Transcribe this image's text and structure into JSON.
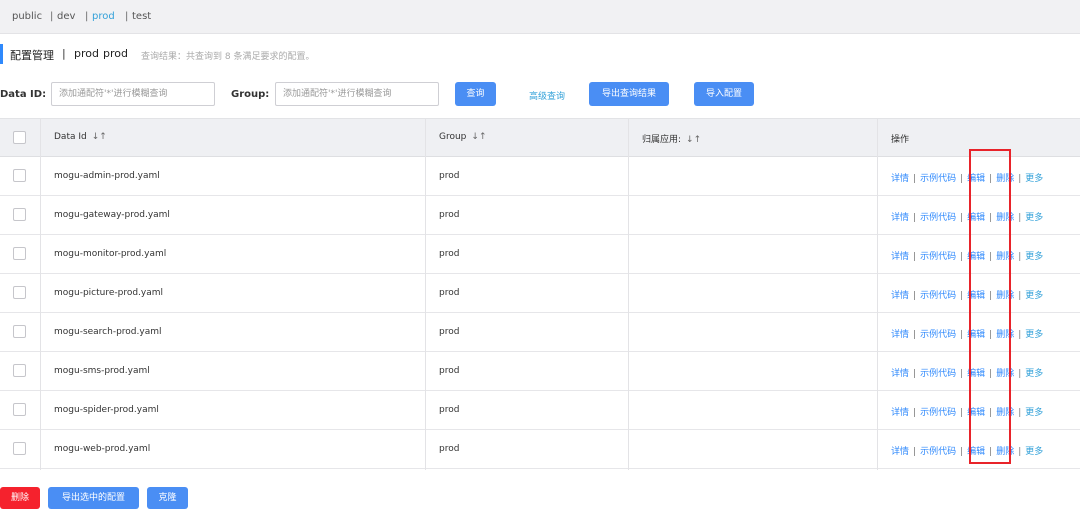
{
  "namespaces": {
    "items": [
      "public",
      "dev",
      "prod",
      "test"
    ],
    "separator": "|",
    "active": "prod"
  },
  "header": {
    "title": "配置管理",
    "separator": "|",
    "namespace_name": "prod",
    "namespace_id": "prod",
    "result_hint": "查询结果：共查询到 8 条满足要求的配置。"
  },
  "search": {
    "data_id_label": "Data ID:",
    "data_id_placeholder": "添加通配符'*'进行模糊查询",
    "group_label": "Group:",
    "group_placeholder": "添加通配符'*'进行模糊查询",
    "query_button": "查询",
    "advanced_link": "高级查询",
    "export_results_button": "导出查询结果",
    "import_button": "导入配置"
  },
  "table": {
    "columns": {
      "data_id": "Data Id",
      "group": "Group",
      "app": "归属应用:",
      "ops": "操作"
    },
    "sort_glyph": "↓↑",
    "op_labels": {
      "detail": "详情",
      "sample": "示例代码",
      "edit": "编辑",
      "delete": "删除",
      "more": "更多",
      "sep": "|"
    },
    "rows": [
      {
        "data_id": "mogu-admin-prod.yaml",
        "group": "prod",
        "app": ""
      },
      {
        "data_id": "mogu-gateway-prod.yaml",
        "group": "prod",
        "app": ""
      },
      {
        "data_id": "mogu-monitor-prod.yaml",
        "group": "prod",
        "app": ""
      },
      {
        "data_id": "mogu-picture-prod.yaml",
        "group": "prod",
        "app": ""
      },
      {
        "data_id": "mogu-search-prod.yaml",
        "group": "prod",
        "app": ""
      },
      {
        "data_id": "mogu-sms-prod.yaml",
        "group": "prod",
        "app": ""
      },
      {
        "data_id": "mogu-spider-prod.yaml",
        "group": "prod",
        "app": ""
      },
      {
        "data_id": "mogu-web-prod.yaml",
        "group": "prod",
        "app": ""
      }
    ]
  },
  "footer": {
    "delete_button": "删除",
    "export_selected_button": "导出选中的配置",
    "clone_button": "克隆"
  },
  "colors": {
    "primary": "#4a8ef4",
    "link": "#2f89fc",
    "danger": "#f5222d",
    "highlight": "#e8232a"
  }
}
